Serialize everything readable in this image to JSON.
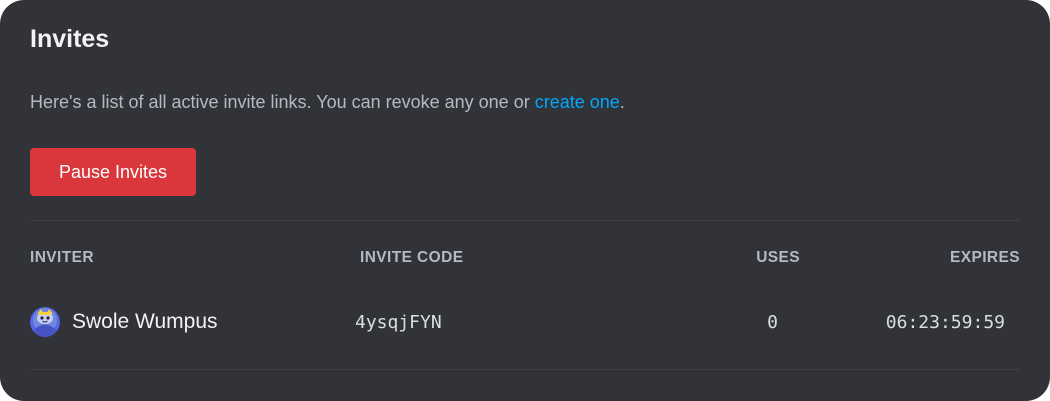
{
  "panel": {
    "title": "Invites",
    "description_prefix": "Here's a list of all active invite links. You can revoke any one or ",
    "description_link": "create one",
    "description_suffix": ".",
    "pause_button_label": "Pause Invites"
  },
  "table": {
    "headers": {
      "inviter": "INVITER",
      "invite_code": "INVITE CODE",
      "uses": "USES",
      "expires": "EXPIRES"
    },
    "rows": [
      {
        "inviter": "Swole Wumpus",
        "avatar_icon": "wumpus-avatar-icon",
        "invite_code": "4ysqjFYN",
        "uses": "0",
        "expires": "06:23:59:59"
      }
    ]
  },
  "colors": {
    "background": "#313338",
    "danger_button": "#da373c",
    "link": "#00a8fc",
    "muted_text": "#b5bac1",
    "divider": "#3f4147"
  }
}
